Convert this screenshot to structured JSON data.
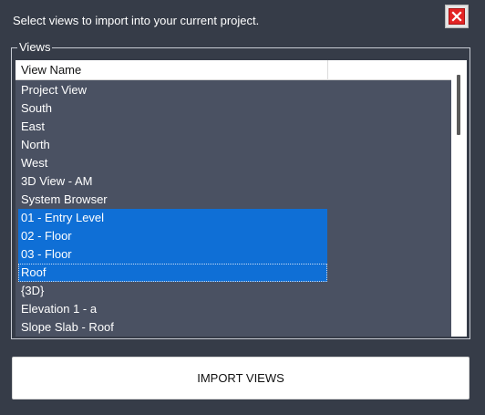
{
  "dialog": {
    "instruction": "Select views to import into your current project.",
    "close_icon": "close-icon",
    "colors": {
      "background": "#363c48",
      "list_background": "#4a5162",
      "selection": "#0f6fd6",
      "close_red": "#e32424"
    }
  },
  "views_group": {
    "legend": "Views",
    "column_header": "View Name",
    "items": [
      {
        "label": "Project View",
        "selected": false
      },
      {
        "label": "South",
        "selected": false
      },
      {
        "label": "East",
        "selected": false
      },
      {
        "label": "North",
        "selected": false
      },
      {
        "label": "West",
        "selected": false
      },
      {
        "label": "3D View - AM",
        "selected": false
      },
      {
        "label": "System Browser",
        "selected": false
      },
      {
        "label": "01 - Entry Level",
        "selected": true
      },
      {
        "label": "02 - Floor",
        "selected": true
      },
      {
        "label": "03 - Floor",
        "selected": true
      },
      {
        "label": "Roof",
        "selected": true,
        "focused": true
      },
      {
        "label": "{3D}",
        "selected": false
      },
      {
        "label": "Elevation 1 - a",
        "selected": false
      },
      {
        "label": "Slope Slab - Roof",
        "selected": false
      }
    ]
  },
  "actions": {
    "import_label": "IMPORT VIEWS"
  }
}
